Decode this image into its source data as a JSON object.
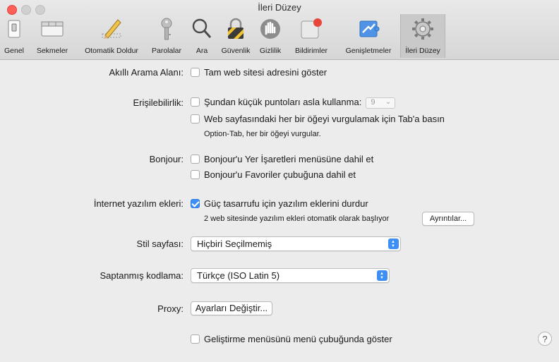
{
  "window": {
    "title": "İleri Düzey"
  },
  "toolbar": {
    "tabs": [
      {
        "label": "Genel",
        "icon": "switch-icon"
      },
      {
        "label": "Sekmeler",
        "icon": "tabs-icon"
      },
      {
        "label": "Otomatik Doldur",
        "icon": "pencil-icon"
      },
      {
        "label": "Parolalar",
        "icon": "key-icon"
      },
      {
        "label": "Ara",
        "icon": "search-icon"
      },
      {
        "label": "Güvenlik",
        "icon": "lock-icon"
      },
      {
        "label": "Gizlilik",
        "icon": "hand-icon"
      },
      {
        "label": "Bildirimler",
        "icon": "notification-icon"
      },
      {
        "label": "Genişletmeler",
        "icon": "puzzle-icon"
      },
      {
        "label": "İleri Düzey",
        "icon": "gear-icon",
        "active": true
      }
    ]
  },
  "settings": {
    "smart_search_label": "Akıllı Arama Alanı:",
    "smart_search_option": "Tam web sitesi adresini göster",
    "accessibility_label": "Erişilebilirlik:",
    "accessibility_font_option": "Şundan küçük puntoları asla kullanma:",
    "accessibility_font_size": "9",
    "accessibility_tab_option": "Web sayfasındaki her bir öğeyi vurgulamak için Tab'a basın",
    "accessibility_tab_note": "Option-Tab, her bir öğeyi vurgular.",
    "bonjour_label": "Bonjour:",
    "bonjour_bookmarks_option": "Bonjour'u Yer İşaretleri menüsüne dahil et",
    "bonjour_favorites_option": "Bonjour'u Favoriler çubuğuna dahil et",
    "plugins_label": "İnternet yazılım ekleri:",
    "plugins_option": "Güç tasarrufu için yazılım eklerini durdur",
    "plugins_note": "2 web sitesinde yazılım ekleri otomatik olarak başlıyor",
    "plugins_details_button": "Ayrıntılar...",
    "stylesheet_label": "Stil sayfası:",
    "stylesheet_value": "Hiçbiri Seçilmemiş",
    "encoding_label": "Saptanmış kodlama:",
    "encoding_value": "Türkçe (ISO Latin 5)",
    "proxy_label": "Proxy:",
    "proxy_button": "Ayarları Değiştir...",
    "develop_option": "Geliştirme menüsünü menü çubuğunda göster",
    "help_label": "?"
  },
  "colors": {
    "accent": "#3b8ff6",
    "close": "#ff5f57",
    "notification_badge": "#e8453c"
  }
}
